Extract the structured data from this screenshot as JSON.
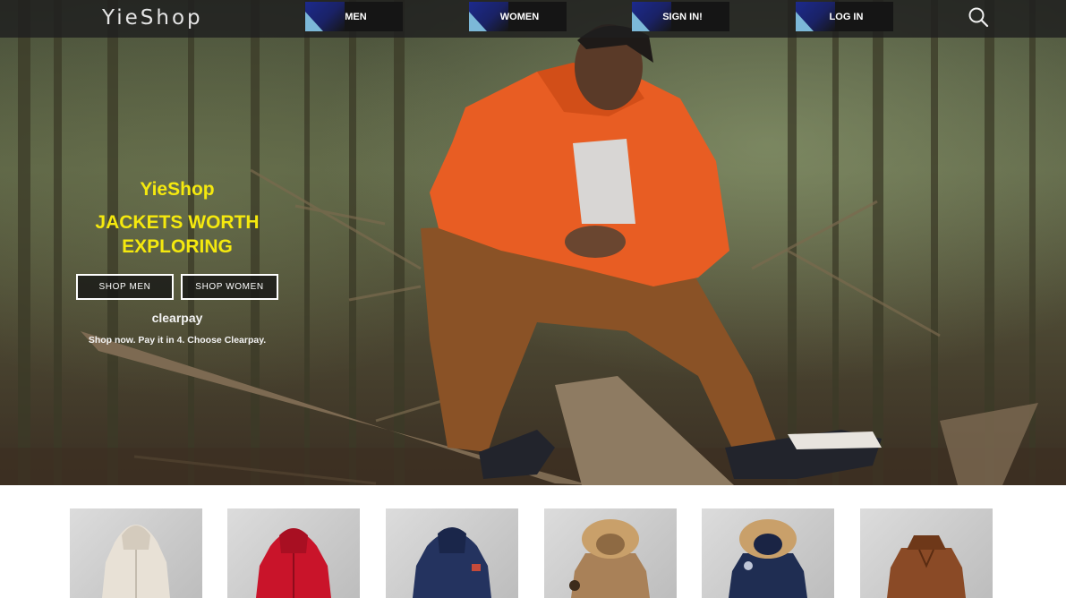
{
  "header": {
    "logo": "YieShop",
    "nav": [
      {
        "label": "MEN"
      },
      {
        "label": "WOMEN"
      },
      {
        "label": "SIGN IN!"
      },
      {
        "label": "LOG IN"
      }
    ],
    "search_icon": "search-icon"
  },
  "hero": {
    "brand": "YieShop",
    "headline_line1": "JACKETS WORTH",
    "headline_line2": "EXPLORING",
    "shop_men_label": "SHOP MEN",
    "shop_women_label": "SHOP WOMEN",
    "clearpay": "clearpay",
    "clearpay_note": "Shop now. Pay it in 4. Choose Clearpay."
  },
  "colors": {
    "accent_yellow": "#f5e90e",
    "nav_dark": "#151515",
    "nav_blue": "#1c2a8c",
    "nav_light_blue": "#7cb8d8"
  },
  "products": [
    {
      "name": "cream puffer jacket",
      "color": "#e8e1d6"
    },
    {
      "name": "red puffer jacket",
      "color": "#c9142a"
    },
    {
      "name": "navy hooded jacket",
      "color": "#24335f"
    },
    {
      "name": "tan fur-hood parka",
      "color": "#a98158"
    },
    {
      "name": "navy fur-hood parka",
      "color": "#1f2d52"
    },
    {
      "name": "brown leather jacket",
      "color": "#8a4a26"
    }
  ]
}
